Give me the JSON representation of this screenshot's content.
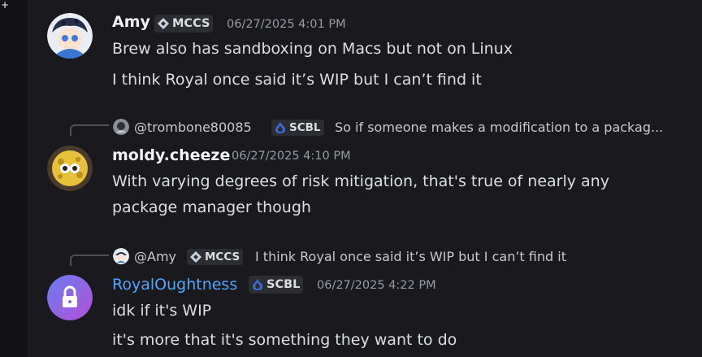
{
  "ui": {
    "add_icon": "plus-icon",
    "add_glyph": "+"
  },
  "messages": [
    {
      "username": "Amy",
      "tag": {
        "label": "MCCS",
        "icon": "diamond-icon"
      },
      "timestamp": "06/27/2025 4:01 PM",
      "lines": [
        "Brew also has sandboxing on Macs but not on Linux",
        "I think Royal once said it’s WIP but I can’t find it"
      ]
    },
    {
      "reply": {
        "username": "@trombone80085",
        "tag": {
          "label": "SCBL",
          "icon": "drop-icon"
        },
        "text": "So if someone makes a modification to a packag..."
      },
      "username": "moldy.cheeze",
      "timestamp": "06/27/2025 4:10 PM",
      "lines": [
        "With varying degrees of risk mitigation, that's true of nearly any",
        "package manager though"
      ]
    },
    {
      "reply": {
        "username": "@Amy",
        "tag": {
          "label": "MCCS",
          "icon": "diamond-icon"
        },
        "text": "I think Royal once said it’s WIP but I can’t find it"
      },
      "username": "RoyalOughtness",
      "name_color": "#4fa6ff",
      "tag": {
        "label": "SCBL",
        "icon": "drop-icon"
      },
      "timestamp": "06/27/2025 4:22 PM",
      "lines": [
        "idk if it's WIP",
        "it's more that it's something they want to do"
      ]
    }
  ]
}
